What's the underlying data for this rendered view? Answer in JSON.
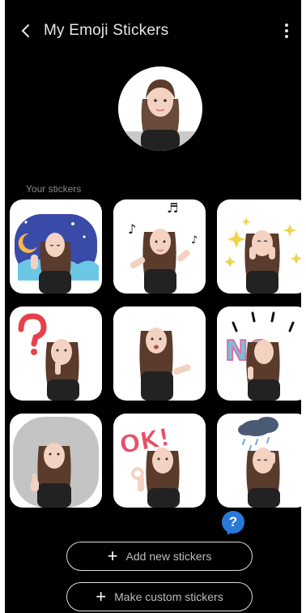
{
  "header": {
    "back_icon": "chevron-left-icon",
    "title": "My Emoji Stickers",
    "more_icon": "more-vertical-icon"
  },
  "profile": {
    "avatar_icon": "emoji-avatar-icon"
  },
  "section": {
    "label": "Your stickers"
  },
  "stickers": [
    {
      "id": "sleepy-night"
    },
    {
      "id": "music-dance"
    },
    {
      "id": "sparkle-happy"
    },
    {
      "id": "question-think"
    },
    {
      "id": "talk-gesture"
    },
    {
      "id": "no-sign"
    },
    {
      "id": "thumbs-up"
    },
    {
      "id": "ok-sign"
    },
    {
      "id": "rain-cloud-sad"
    }
  ],
  "sticker_text": {
    "no": "NO",
    "ok": "OK!"
  },
  "help": {
    "label": "?"
  },
  "actions": {
    "add_new": "Add new stickers",
    "make_custom": "Make custom stickers"
  },
  "colors": {
    "background": "#000000",
    "help_blue": "#2a79d8",
    "night_blue": "#3a4aa8"
  }
}
